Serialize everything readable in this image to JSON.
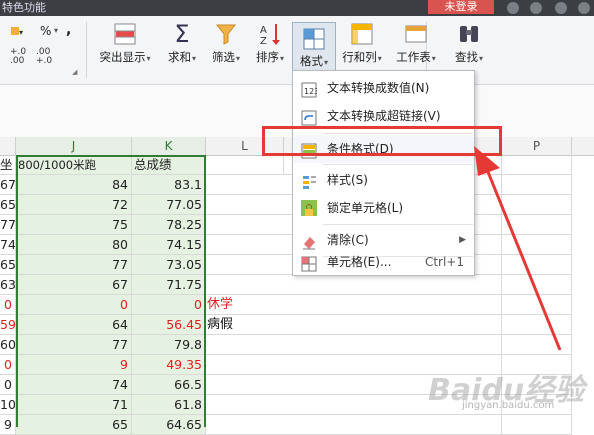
{
  "titlebar": {
    "title": "特色功能",
    "login_label": "未登录"
  },
  "ribbon": {
    "highlight_label": "突出显示",
    "sum_label": "求和",
    "filter_label": "筛选",
    "sort_label": "排序",
    "format_label": "格式",
    "rowcol_label": "行和列",
    "sheet_label": "工作表",
    "find_label": "查找",
    "percent": "%",
    "comma": ","
  },
  "columns": [
    "J",
    "K",
    "L",
    "P"
  ],
  "header_row": {
    "i_partial": "坐",
    "j": "800/1000米跑",
    "k": "总成绩"
  },
  "rows": [
    {
      "i": "67",
      "j": "84",
      "k": "83.1"
    },
    {
      "i": "65",
      "j": "72",
      "k": "77.05"
    },
    {
      "i": "77",
      "j": "75",
      "k": "78.25"
    },
    {
      "i": "74",
      "j": "80",
      "k": "74.15"
    },
    {
      "i": "65",
      "j": "77",
      "k": "73.05"
    },
    {
      "i": "63",
      "j": "67",
      "k": "71.75"
    },
    {
      "i": "0",
      "j": "0",
      "k": "0",
      "note": "休学",
      "red": true
    },
    {
      "i": "59",
      "j": "64",
      "k": "56.45",
      "note": "病假",
      "red_i": true,
      "red_k": true
    },
    {
      "i": "60",
      "j": "77",
      "k": "79.8"
    },
    {
      "i": "0",
      "j": "9",
      "k": "49.35",
      "red": true
    },
    {
      "i": "0",
      "j": "74",
      "k": "66.5"
    },
    {
      "i": "10",
      "j": "71",
      "k": "61.8"
    },
    {
      "i": "9",
      "j": "65",
      "k": "64.65"
    }
  ],
  "menu": {
    "items": [
      {
        "label": "文本转换成数值(N)",
        "icon": "text-to-number-icon"
      },
      {
        "label": "文本转换成超链接(V)",
        "icon": "hyperlink-icon"
      },
      {
        "label": "条件格式(D)",
        "icon": "conditional-format-icon"
      },
      {
        "label": "样式(S)",
        "icon": "style-icon"
      },
      {
        "label": "锁定单元格(L)",
        "icon": "lock-icon"
      },
      {
        "label": "清除(C)",
        "icon": "eraser-icon"
      },
      {
        "label": "单元格(E)...",
        "icon": "cell-icon",
        "shortcut": "Ctrl+1"
      }
    ]
  },
  "watermark": {
    "text": "Baidu经验",
    "sub": "jingyan.baidu.com"
  },
  "colors": {
    "selection": "#2e7d32",
    "highlight_box": "#e53935",
    "red_text": "#e02020"
  }
}
